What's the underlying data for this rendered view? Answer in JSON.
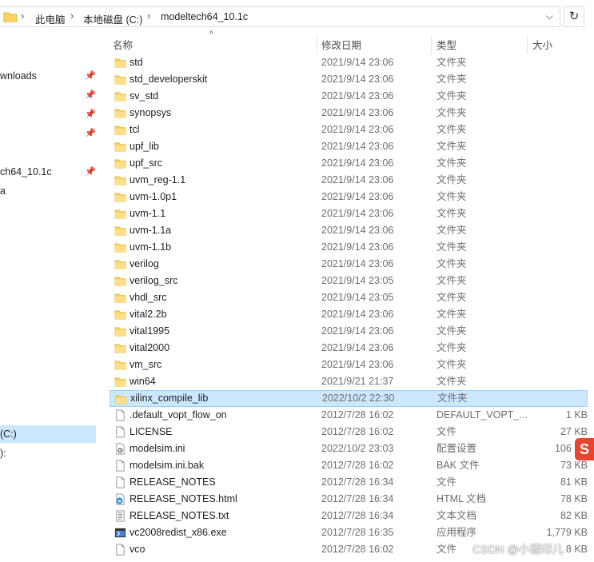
{
  "address_bar": {
    "segments": [
      "此电脑",
      "本地磁盘 (C:)",
      "modeltech64_10.1c"
    ]
  },
  "nav": {
    "items": [
      {
        "label": "wnloads",
        "pinned": true
      },
      {
        "label": "",
        "pinned": true
      },
      {
        "label": "",
        "pinned": true
      },
      {
        "label": "",
        "pinned": true
      },
      {
        "label": "ch64_10.1c",
        "pinned": true
      },
      {
        "label": "a",
        "pinned": false
      }
    ],
    "drive_selected": "(C:)",
    "drive_other": "):"
  },
  "columns": {
    "name": "名称",
    "date": "修改日期",
    "type": "类型",
    "size": "大小"
  },
  "files": [
    {
      "name": "std",
      "date": "2021/9/14 23:06",
      "type": "文件夹",
      "size": "",
      "icon": "folder"
    },
    {
      "name": "std_developerskit",
      "date": "2021/9/14 23:06",
      "type": "文件夹",
      "size": "",
      "icon": "folder"
    },
    {
      "name": "sv_std",
      "date": "2021/9/14 23:06",
      "type": "文件夹",
      "size": "",
      "icon": "folder"
    },
    {
      "name": "synopsys",
      "date": "2021/9/14 23:06",
      "type": "文件夹",
      "size": "",
      "icon": "folder"
    },
    {
      "name": "tcl",
      "date": "2021/9/14 23:06",
      "type": "文件夹",
      "size": "",
      "icon": "folder"
    },
    {
      "name": "upf_lib",
      "date": "2021/9/14 23:06",
      "type": "文件夹",
      "size": "",
      "icon": "folder"
    },
    {
      "name": "upf_src",
      "date": "2021/9/14 23:06",
      "type": "文件夹",
      "size": "",
      "icon": "folder"
    },
    {
      "name": "uvm_reg-1.1",
      "date": "2021/9/14 23:06",
      "type": "文件夹",
      "size": "",
      "icon": "folder"
    },
    {
      "name": "uvm-1.0p1",
      "date": "2021/9/14 23:06",
      "type": "文件夹",
      "size": "",
      "icon": "folder"
    },
    {
      "name": "uvm-1.1",
      "date": "2021/9/14 23:06",
      "type": "文件夹",
      "size": "",
      "icon": "folder"
    },
    {
      "name": "uvm-1.1a",
      "date": "2021/9/14 23:06",
      "type": "文件夹",
      "size": "",
      "icon": "folder"
    },
    {
      "name": "uvm-1.1b",
      "date": "2021/9/14 23:06",
      "type": "文件夹",
      "size": "",
      "icon": "folder"
    },
    {
      "name": "verilog",
      "date": "2021/9/14 23:06",
      "type": "文件夹",
      "size": "",
      "icon": "folder"
    },
    {
      "name": "verilog_src",
      "date": "2021/9/14 23:05",
      "type": "文件夹",
      "size": "",
      "icon": "folder"
    },
    {
      "name": "vhdl_src",
      "date": "2021/9/14 23:05",
      "type": "文件夹",
      "size": "",
      "icon": "folder"
    },
    {
      "name": "vital2.2b",
      "date": "2021/9/14 23:06",
      "type": "文件夹",
      "size": "",
      "icon": "folder"
    },
    {
      "name": "vital1995",
      "date": "2021/9/14 23:06",
      "type": "文件夹",
      "size": "",
      "icon": "folder"
    },
    {
      "name": "vital2000",
      "date": "2021/9/14 23:06",
      "type": "文件夹",
      "size": "",
      "icon": "folder"
    },
    {
      "name": "vm_src",
      "date": "2021/9/14 23:06",
      "type": "文件夹",
      "size": "",
      "icon": "folder"
    },
    {
      "name": "win64",
      "date": "2021/9/21 21:37",
      "type": "文件夹",
      "size": "",
      "icon": "folder"
    },
    {
      "name": "xilinx_compile_lib",
      "date": "2022/10/2 22:30",
      "type": "文件夹",
      "size": "",
      "icon": "folder",
      "selected": true
    },
    {
      "name": ".default_vopt_flow_on",
      "date": "2012/7/28 16:02",
      "type": "DEFAULT_VOPT_...",
      "size": "1 KB",
      "icon": "file"
    },
    {
      "name": "LICENSE",
      "date": "2012/7/28 16:02",
      "type": "文件",
      "size": "27 KB",
      "icon": "file"
    },
    {
      "name": "modelsim.ini",
      "date": "2022/10/2 23:03",
      "type": "配置设置",
      "size": "106 KB",
      "icon": "ini"
    },
    {
      "name": "modelsim.ini.bak",
      "date": "2012/7/28 16:02",
      "type": "BAK 文件",
      "size": "73 KB",
      "icon": "file"
    },
    {
      "name": "RELEASE_NOTES",
      "date": "2012/7/28 16:34",
      "type": "文件",
      "size": "81 KB",
      "icon": "file"
    },
    {
      "name": "RELEASE_NOTES.html",
      "date": "2012/7/28 16:34",
      "type": "HTML 文档",
      "size": "78 KB",
      "icon": "html"
    },
    {
      "name": "RELEASE_NOTES.txt",
      "date": "2012/7/28 16:34",
      "type": "文本文档",
      "size": "82 KB",
      "icon": "txt"
    },
    {
      "name": "vc2008redist_x86.exe",
      "date": "2012/7/28 16:35",
      "type": "应用程序",
      "size": "1,779 KB",
      "icon": "exe"
    },
    {
      "name": "vco",
      "date": "2012/7/28 16:02",
      "type": "文件",
      "size": "8 KB",
      "icon": "file"
    }
  ],
  "watermark": "CSDN @小德印儿",
  "ime_badge": "S",
  "colors": {
    "selection_bg": "#cce8ff",
    "selection_border": "#99d1ff",
    "folder": "#ffd25c"
  }
}
